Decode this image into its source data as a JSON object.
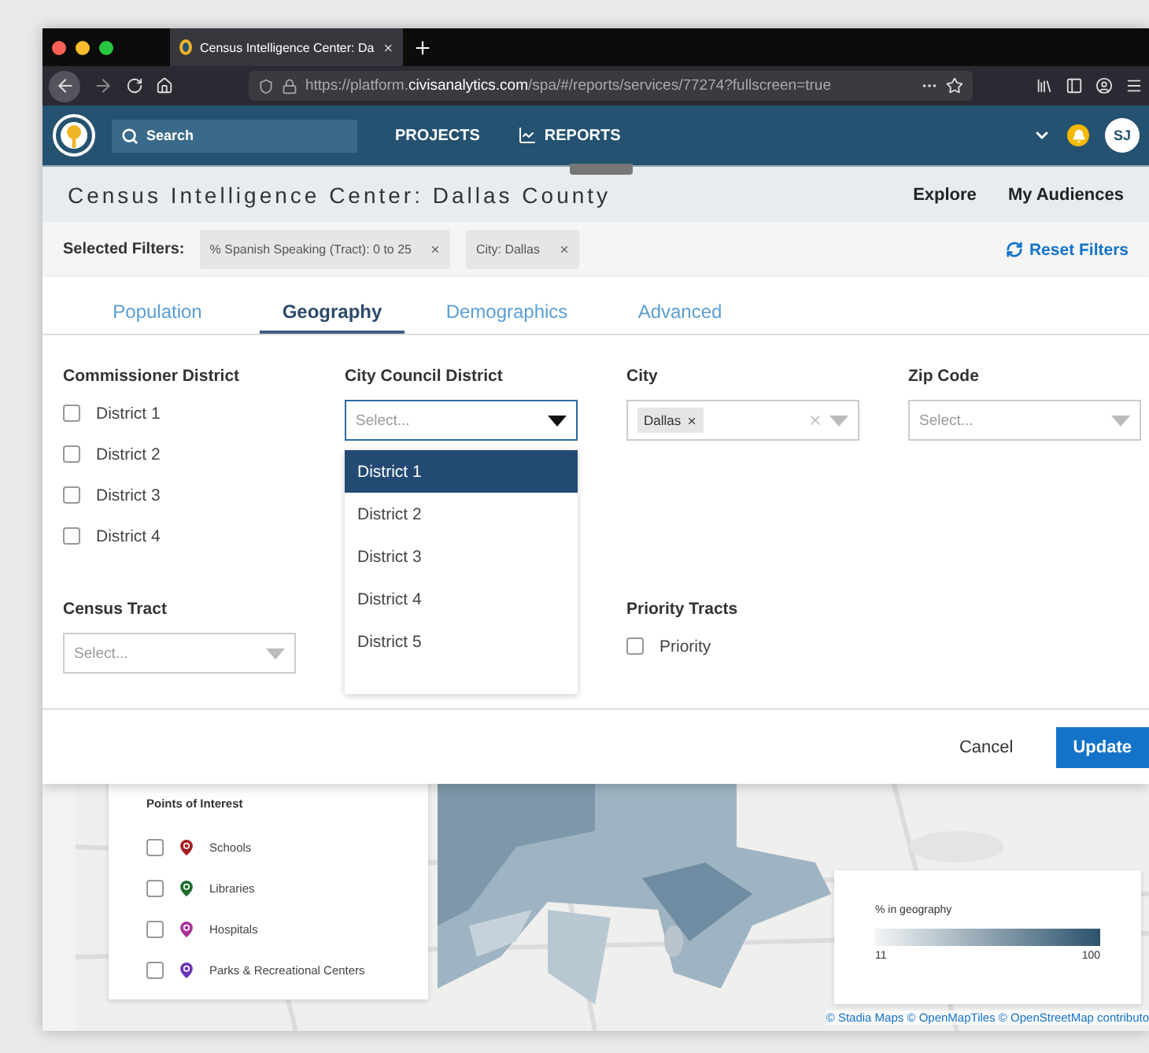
{
  "browser": {
    "tab_title": "Census Intelligence Center: Da",
    "url": "https://platform.**civisanalytics.com**/spa/#/reports/services/77274?fullscreen=true"
  },
  "app": {
    "search_placeholder": "Search",
    "nav": [
      "PROJECTS",
      "REPORTS"
    ],
    "avatar": "SJ"
  },
  "header": {
    "title": "Census Intelligence Center: Dallas County",
    "links": [
      "Explore",
      "My Audiences"
    ]
  },
  "filters": {
    "label": "Selected Filters:",
    "chips": [
      "% Spanish Speaking (Tract): 0 to 25",
      "City: Dallas"
    ],
    "reset": "Reset Filters"
  },
  "tabs": [
    {
      "label": "Population",
      "selected": false
    },
    {
      "label": "Geography",
      "selected": true
    },
    {
      "label": "Demographics",
      "selected": false
    },
    {
      "label": "Advanced",
      "selected": false
    }
  ],
  "fields": [
    {
      "kind": "checkboxes",
      "label": "Commissioner District",
      "options": [
        {
          "label": "District 1",
          "checked": false
        },
        {
          "label": "District 2",
          "checked": false
        },
        {
          "label": "District 3",
          "checked": false
        },
        {
          "label": "District 4",
          "checked": false
        }
      ]
    },
    {
      "kind": "select",
      "label": "City Council District",
      "placeholder": "Select...",
      "open": true,
      "menu": [
        {
          "label": "District 1",
          "selected": true
        },
        {
          "label": "District 2",
          "selected": false
        },
        {
          "label": "District 3",
          "selected": false
        },
        {
          "label": "District 4",
          "selected": false
        },
        {
          "label": "District 5",
          "selected": false
        }
      ]
    },
    {
      "kind": "select",
      "label": "City",
      "values": [
        "Dallas"
      ],
      "open": false
    },
    {
      "kind": "select",
      "label": "Zip Code",
      "placeholder": "Select...",
      "open": false
    },
    {
      "kind": "select",
      "label": "Census Tract",
      "placeholder": "Select...",
      "open": false
    },
    {
      "kind": "checkboxes",
      "label": "Priority Tracts",
      "options": [
        {
          "label": "Priority",
          "checked": false
        }
      ]
    }
  ],
  "footer": {
    "buttons": [
      {
        "label": "Cancel",
        "kind": "secondary"
      },
      {
        "label": "Update",
        "kind": "primary"
      }
    ]
  },
  "map": {
    "poi_title": "Points of Interest",
    "poi": [
      {
        "label": "Schools",
        "color": "#a61d24",
        "checked": false
      },
      {
        "label": "Libraries",
        "color": "#1e6b2e",
        "checked": false
      },
      {
        "label": "Hospitals",
        "color": "#a8329a",
        "checked": false
      },
      {
        "label": "Parks & Recreational Centers",
        "color": "#6a35b5",
        "checked": false
      }
    ],
    "legend": {
      "title": "% in geography",
      "min": "11",
      "max": "100"
    },
    "attribution": "© Stadia Maps © OpenMapTiles © OpenStreetMap contributo"
  }
}
